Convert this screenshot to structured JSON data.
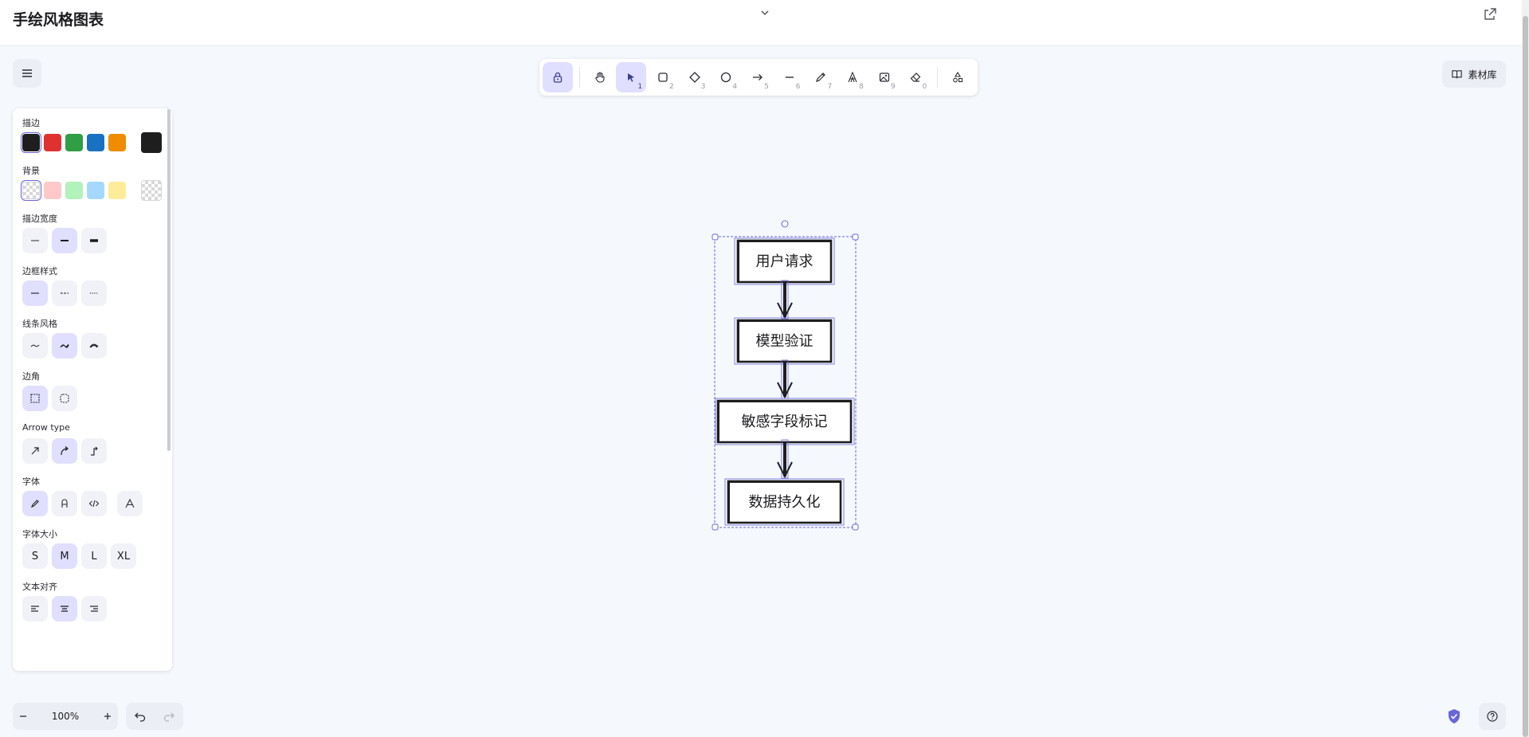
{
  "app": {
    "title": "手绘风格图表"
  },
  "toolbar": {
    "tools": [
      {
        "name": "lock",
        "key": ""
      },
      {
        "name": "hand",
        "key": ""
      },
      {
        "name": "selection",
        "key": "1"
      },
      {
        "name": "rectangle",
        "key": "2"
      },
      {
        "name": "diamond",
        "key": "3"
      },
      {
        "name": "ellipse",
        "key": "4"
      },
      {
        "name": "arrow",
        "key": "5"
      },
      {
        "name": "line",
        "key": "6"
      },
      {
        "name": "draw",
        "key": "7"
      },
      {
        "name": "text",
        "key": "8"
      },
      {
        "name": "image",
        "key": "9"
      },
      {
        "name": "eraser",
        "key": "0"
      },
      {
        "name": "more-shapes",
        "key": ""
      }
    ],
    "active_tools": [
      "lock",
      "selection"
    ]
  },
  "library": {
    "label": "素材库"
  },
  "properties": {
    "stroke": {
      "label": "描边",
      "colors": [
        "#1e1e1e",
        "#e03131",
        "#2f9e44",
        "#1971c2",
        "#f08c00"
      ],
      "current": "#1e1e1e"
    },
    "background": {
      "label": "背景",
      "colors": [
        "transparent",
        "#ffc9c9",
        "#b2f2bb",
        "#a5d8ff",
        "#ffec99"
      ],
      "current": "transparent"
    },
    "stroke_width": {
      "label": "描边宽度",
      "options": [
        "thin",
        "bold",
        "extra-bold"
      ],
      "selected": "bold"
    },
    "stroke_style": {
      "label": "边框样式",
      "options": [
        "solid",
        "dashed",
        "dotted"
      ],
      "selected": "solid"
    },
    "sloppiness": {
      "label": "线条风格",
      "options": [
        "architect",
        "artist",
        "cartoonist"
      ],
      "selected": "artist"
    },
    "edges": {
      "label": "边角",
      "options": [
        "sharp",
        "round"
      ],
      "selected": "sharp"
    },
    "arrow_type": {
      "label": "Arrow type",
      "options": [
        "sharp",
        "curved",
        "elbow"
      ],
      "selected": "curved"
    },
    "font_family": {
      "label": "字体",
      "options": [
        "hand-drawn",
        "normal",
        "code",
        "more"
      ],
      "selected": "hand-drawn"
    },
    "font_size": {
      "label": "字体大小",
      "options": [
        "S",
        "M",
        "L",
        "XL"
      ],
      "selected": "M"
    },
    "text_align": {
      "label": "文本对齐",
      "options": [
        "left",
        "center",
        "right"
      ],
      "selected": "center"
    }
  },
  "zoom": {
    "level": "100%"
  },
  "diagram": {
    "nodes": [
      "用户请求",
      "模型验证",
      "敏感字段标记",
      "数据持久化"
    ],
    "stroke_color": "#1e1e1e",
    "selection_color": "#6965db"
  }
}
